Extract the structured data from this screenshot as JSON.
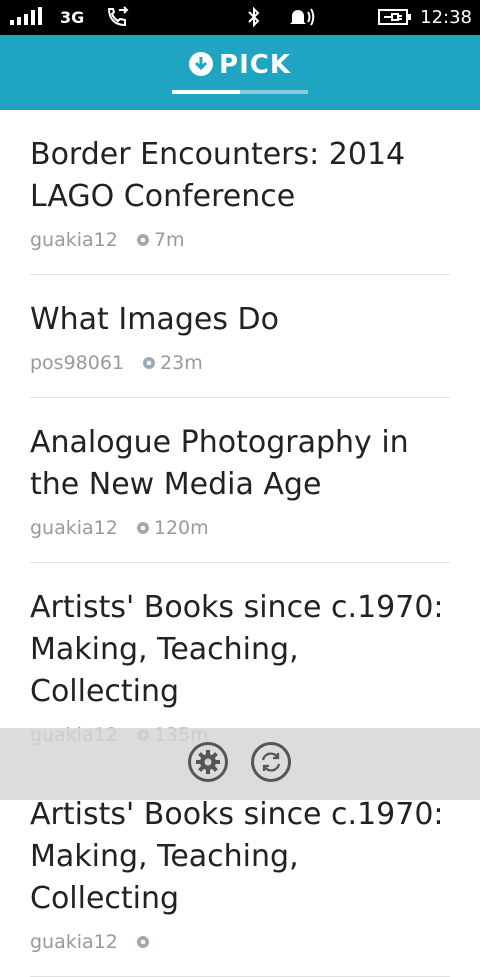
{
  "status": {
    "network": "3G",
    "time": "12:38"
  },
  "header": {
    "title": "PICK",
    "tab_progress": 0.5
  },
  "items": [
    {
      "title": "Border Encounters: 2014 LAGO Conference",
      "user": "guakia12",
      "distance": "7m"
    },
    {
      "title": "What Images Do",
      "user": "pos98061",
      "distance": "23m"
    },
    {
      "title": "Analogue Photography in the New Media Age",
      "user": "guakia12",
      "distance": "120m"
    },
    {
      "title": "Artists' Books since c.1970: Making, Teaching, Collecting",
      "user": "guakia12",
      "distance": "135m"
    },
    {
      "title": "Artists' Books since c.1970: Making, Teaching, Collecting",
      "user": "guakia12",
      "distance": ""
    }
  ],
  "appbar": {
    "icons": [
      "settings-icon",
      "refresh-icon"
    ]
  }
}
